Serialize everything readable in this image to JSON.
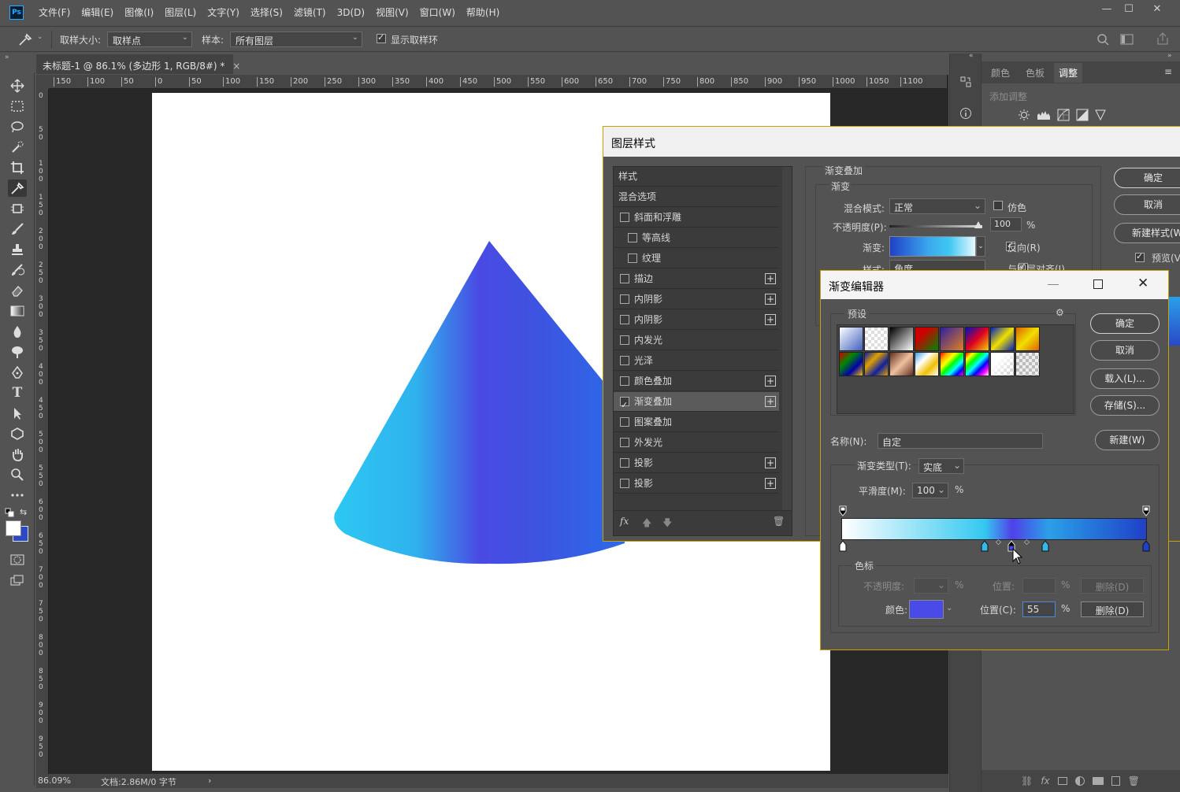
{
  "menubar": {
    "logo": "Ps",
    "items": [
      "文件(F)",
      "编辑(E)",
      "图像(I)",
      "图层(L)",
      "文字(Y)",
      "选择(S)",
      "滤镜(T)",
      "3D(D)",
      "视图(V)",
      "窗口(W)",
      "帮助(H)"
    ],
    "win_min": "—",
    "win_max": "☐",
    "win_close": "✕"
  },
  "options": {
    "sample_size_label": "取样大小:",
    "sample_size_value": "取样点",
    "sample_label": "样本:",
    "sample_value": "所有图层",
    "show_ring_label": "显示取样环",
    "show_ring_checked": true
  },
  "document": {
    "tab_title": "未标题-1 @ 86.1% (多边形 1, RGB/8#) *",
    "tab_close": "×",
    "ruler_h": [
      "150",
      "100",
      "50",
      "0",
      "50",
      "100",
      "150",
      "200",
      "250",
      "300",
      "350",
      "400",
      "450",
      "500",
      "550",
      "600",
      "650",
      "700",
      "750",
      "800",
      "850",
      "900",
      "950",
      "1000",
      "1050",
      "1100"
    ],
    "ruler_v": [
      "0",
      "5\n0",
      "1\n0\n0",
      "1\n5\n0",
      "2\n0\n0",
      "2\n5\n0",
      "3\n0\n0",
      "3\n5\n0",
      "4\n0\n0",
      "4\n5\n0",
      "5\n0\n0",
      "5\n5\n0",
      "6\n0\n0",
      "6\n5\n0",
      "7\n0\n0",
      "7\n5\n0",
      "8\n0\n0",
      "8\n5\n0",
      "9\n0\n0",
      "9\n5\n0"
    ],
    "zoom": "86.09%",
    "doc_info": "文档:2.86M/0 字节",
    "status_arrow": "›"
  },
  "right_panel": {
    "tabs": [
      "颜色",
      "色板",
      "调整"
    ],
    "active_tab": "调整",
    "add_adjust": "添加调整"
  },
  "layer_style": {
    "title": "图层样式",
    "list_header": "样式",
    "blend_options": "混合选项",
    "items": [
      {
        "label": "斜面和浮雕",
        "checked": false,
        "plus": false,
        "indent": false
      },
      {
        "label": "等高线",
        "checked": false,
        "plus": false,
        "indent": true
      },
      {
        "label": "纹理",
        "checked": false,
        "plus": false,
        "indent": true
      },
      {
        "label": "描边",
        "checked": false,
        "plus": true,
        "indent": false
      },
      {
        "label": "内阴影",
        "checked": false,
        "plus": true,
        "indent": false
      },
      {
        "label": "内阴影",
        "checked": false,
        "plus": true,
        "indent": false
      },
      {
        "label": "内发光",
        "checked": false,
        "plus": false,
        "indent": false
      },
      {
        "label": "光泽",
        "checked": false,
        "plus": false,
        "indent": false
      },
      {
        "label": "颜色叠加",
        "checked": false,
        "plus": true,
        "indent": false
      },
      {
        "label": "渐变叠加",
        "checked": true,
        "plus": true,
        "indent": false
      },
      {
        "label": "图案叠加",
        "checked": false,
        "plus": false,
        "indent": false
      },
      {
        "label": "外发光",
        "checked": false,
        "plus": false,
        "indent": false
      },
      {
        "label": "投影",
        "checked": false,
        "plus": true,
        "indent": false
      },
      {
        "label": "投影",
        "checked": false,
        "plus": true,
        "indent": false
      }
    ],
    "fx_label": "fx",
    "section_title": "渐变叠加",
    "subsection": "渐变",
    "blend_mode_label": "混合模式:",
    "blend_mode_value": "正常",
    "dither_label": "仿色",
    "opacity_label": "不透明度(P):",
    "opacity_value": "100",
    "percent": "%",
    "gradient_label": "渐变:",
    "reverse_label": "反向(R)",
    "style_label": "样式:",
    "style_value": "角度",
    "align_label": "与图层对齐(I)",
    "ok": "确定",
    "cancel": "取消",
    "new_style": "新建样式(W)...",
    "preview": "预览(V)"
  },
  "gradient_editor": {
    "title": "渐变编辑器",
    "presets_label": "预设",
    "ok": "确定",
    "cancel": "取消",
    "load": "载入(L)...",
    "save": "存储(S)...",
    "name_label": "名称(N):",
    "name_value": "自定",
    "new_button": "新建(W)",
    "type_label": "渐变类型(T):",
    "type_value": "实底",
    "smooth_label": "平滑度(M):",
    "smooth_value": "100",
    "percent": "%",
    "stops_group": "色标",
    "opacity_label": "不透明度:",
    "location_label": "位置:",
    "delete_label": "删除(D)",
    "color_label": "颜色:",
    "color_location_label": "位置(C):",
    "color_location_value": "55",
    "color_delete_label": "删除(D)",
    "stop_color": "#4a4ae8",
    "gradient_colors": [
      "#ffffff",
      "#34c8f0",
      "#5040e8",
      "#2aa0e8",
      "#2040c8"
    ]
  }
}
